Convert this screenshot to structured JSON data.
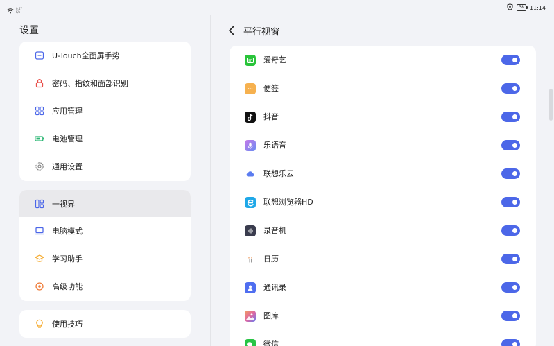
{
  "status": {
    "speed_top": "0.47",
    "speed_bottom": "K/s",
    "battery": "38",
    "time": "11:14"
  },
  "left": {
    "title": "设置",
    "group1": [
      {
        "label": "U-Touch全面屏手势",
        "icon": "gesture-icon"
      },
      {
        "label": "密码、指纹和面部识别",
        "icon": "lock-icon"
      },
      {
        "label": "应用管理",
        "icon": "apps-grid-icon"
      },
      {
        "label": "电池管理",
        "icon": "battery-icon"
      },
      {
        "label": "通用设置",
        "icon": "gear-icon"
      }
    ],
    "group2": [
      {
        "label": "一视界",
        "icon": "split-view-icon"
      },
      {
        "label": "电脑模式",
        "icon": "laptop-icon"
      },
      {
        "label": "学习助手",
        "icon": "graduation-cap-icon"
      },
      {
        "label": "高级功能",
        "icon": "advanced-features-icon"
      }
    ],
    "group3": [
      {
        "label": "使用技巧",
        "icon": "lightbulb-icon"
      }
    ]
  },
  "right": {
    "title": "平行视窗",
    "apps": [
      {
        "name": "爱奇艺",
        "icon": "iqiyi-icon",
        "enabled": true
      },
      {
        "name": "便签",
        "icon": "notes-icon",
        "enabled": true
      },
      {
        "name": "抖音",
        "icon": "douyin-icon",
        "enabled": true
      },
      {
        "name": "乐语音",
        "icon": "voice-assistant-icon",
        "enabled": true
      },
      {
        "name": "联想乐云",
        "icon": "cloud-icon",
        "enabled": true
      },
      {
        "name": "联想浏览器HD",
        "icon": "browser-icon",
        "enabled": true
      },
      {
        "name": "录音机",
        "icon": "recorder-icon",
        "enabled": true
      },
      {
        "name": "日历",
        "icon": "calendar-icon",
        "enabled": true
      },
      {
        "name": "通讯录",
        "icon": "contacts-icon",
        "enabled": true
      },
      {
        "name": "图库",
        "icon": "gallery-icon",
        "enabled": true
      },
      {
        "name": "微信",
        "icon": "wechat-icon",
        "enabled": true
      }
    ]
  },
  "colors": {
    "accent": "#4c67e8",
    "background": "#f2f3f7"
  }
}
